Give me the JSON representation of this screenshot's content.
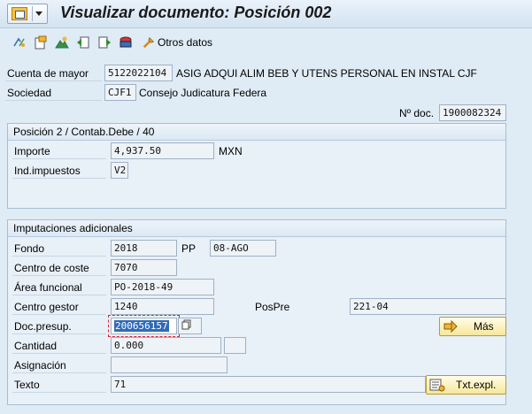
{
  "window": {
    "title": "Visualizar documento: Posición 002"
  },
  "toolbar": {
    "otros_datos_label": "Otros datos"
  },
  "header": {
    "cuenta_label": "Cuenta de mayor",
    "cuenta_value": "5122022104",
    "cuenta_desc": "ASIG ADQUI ALIM BEB Y UTENS PERSONAL EN INSTAL CJF",
    "sociedad_label": "Sociedad",
    "sociedad_value": "CJF1",
    "sociedad_desc": "Consejo Judicatura Federa",
    "ndoc_label": "Nº doc.",
    "ndoc_value": "1900082324"
  },
  "posicion": {
    "title": "Posición 2 / Contab.Debe / 40",
    "importe_label": "Importe",
    "importe_value": "4,937.50",
    "moneda": "MXN",
    "indimp_label": "Ind.impuestos",
    "indimp_value": "V2"
  },
  "imputaciones": {
    "title": "Imputaciones adicionales",
    "fondo_label": "Fondo",
    "fondo_value": "2018",
    "pp_label": "PP",
    "pp_value": "08-AGO",
    "ceco_label": "Centro de coste",
    "ceco_value": "7070",
    "area_label": "Área funcional",
    "area_value": "PO-2018-49",
    "cgestor_label": "Centro gestor",
    "cgestor_value": "1240",
    "pospre_label": "PosPre",
    "pospre_value": "221-04",
    "docpresup_label": "Doc.presup.",
    "docpresup_value": "200656157",
    "mas_label": "Más",
    "cantidad_label": "Cantidad",
    "cantidad_value": "0.000",
    "asignacion_label": "Asignación",
    "asignacion_value": "",
    "texto_label": "Texto",
    "texto_value": "71",
    "txtexpl_label": "Txt.expl."
  }
}
